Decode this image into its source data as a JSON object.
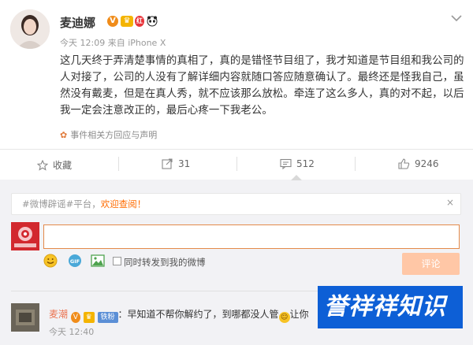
{
  "post": {
    "username": "麦迪娜",
    "meta": "今天 12:09 来自 iPhone X",
    "content": "这几天终于弄清楚事情的真相了，真的是错怪节目组了，我才知道是节目组和我公司的人对接了，公司的人没有了解详细内容就随口答应随意确认了。最终还是怪我自己，虽然没有戴麦，但是在真人秀，就不应该那么放松。牵连了这么多人，真的对不起，以后我一定会注意改正的，最后心疼一下我老公。",
    "source_label": "事件相关方回应与声明"
  },
  "actions": {
    "collect": "收藏",
    "repost": "31",
    "comment": "512",
    "like": "9246"
  },
  "comment_box": {
    "topic_prefix": "#微博辟谣#平台，",
    "topic_link": "欢迎查阅！",
    "close": "×",
    "repost_check_label": "同时转发到我的微博",
    "submit_label": "评论"
  },
  "reply": {
    "name": "麦潮",
    "tag": "铁粉",
    "text": "：早知道不帮你解约了，到哪都没人管",
    "tail": "让你",
    "time": "今天 12:40"
  },
  "watermark": "誉祥祥知识",
  "colors": {
    "accent": "#eb7350",
    "submit_disabled": "#ffc7a6",
    "watermark_bg": "#0d5fd6"
  }
}
